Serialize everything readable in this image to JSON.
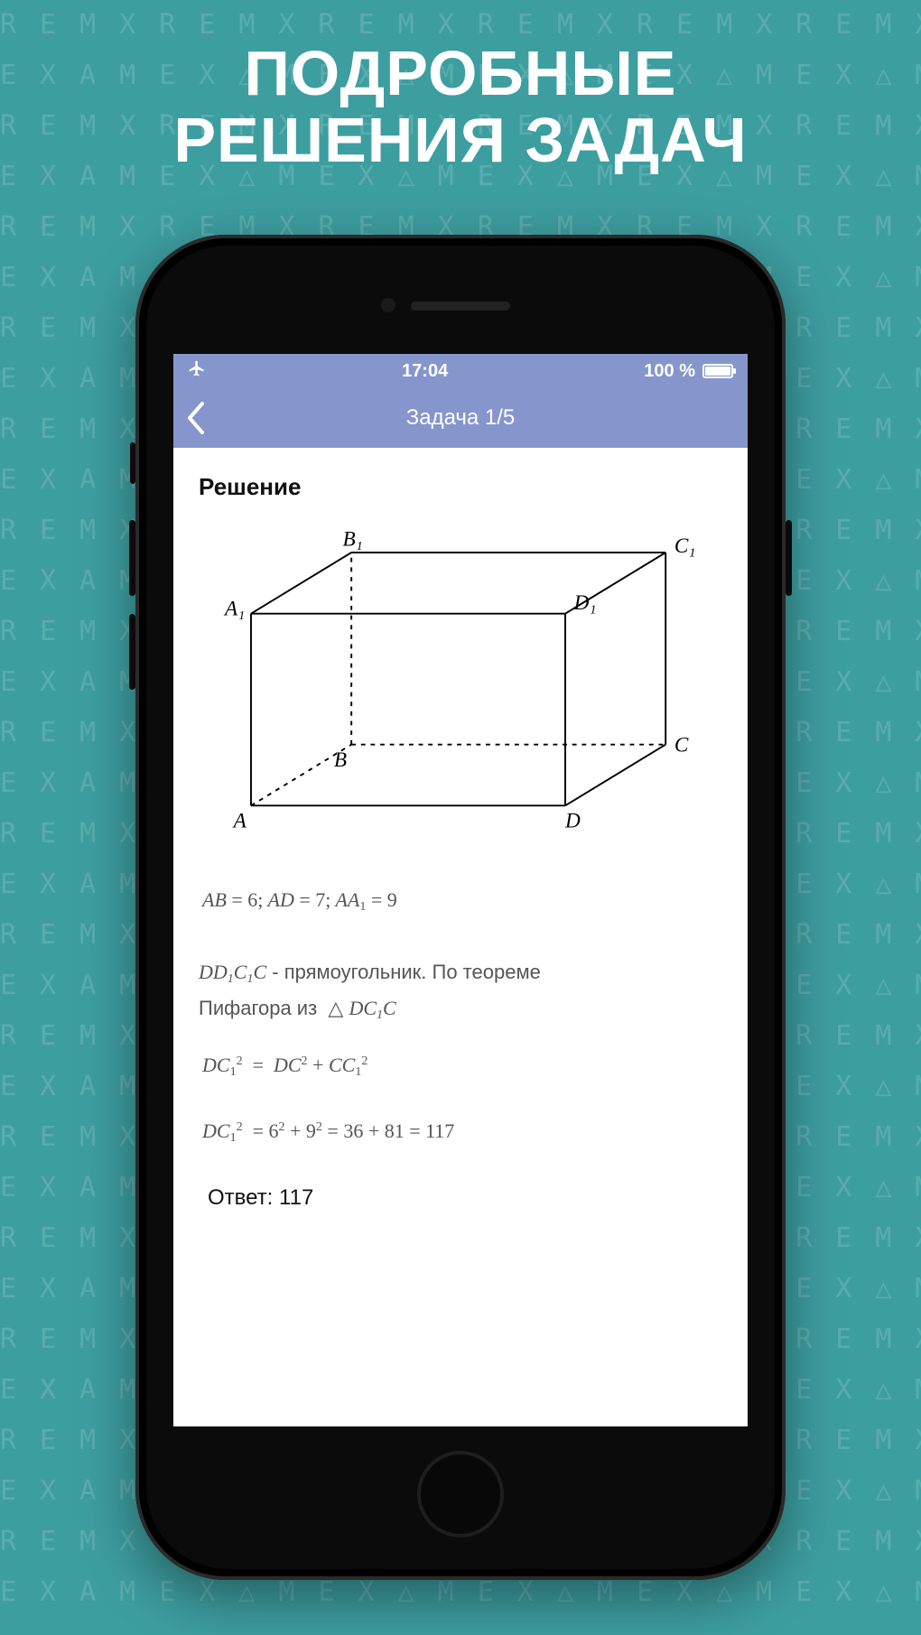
{
  "promo": {
    "line1": "ПОДРОБНЫЕ",
    "line2": "РЕШЕНИЯ ЗАДАЧ"
  },
  "status": {
    "time": "17:04",
    "battery_text": "100 %",
    "airplane_icon": "airplane-icon"
  },
  "nav": {
    "title": "Задача 1/5",
    "back_icon": "chevron-left-icon"
  },
  "solution": {
    "heading": "Решение",
    "figure": {
      "labels": {
        "A": "A",
        "B": "B",
        "C": "C",
        "D": "D",
        "A1": "A₁",
        "B1": "B₁",
        "C1": "C₁",
        "D1": "D₁"
      }
    },
    "given": "AB = 6; AD = 7; AA₁ = 9",
    "line2a": "DD₁C₁C - прямоугольник. По теореме",
    "line2b": "Пифагора из  △ DC₁C",
    "eq1": "DC₁² = DC² + CC₁²",
    "eq2": "DC₁² = 6² + 9² = 36 + 81 = 117",
    "answer_label": "Ответ:",
    "answer_value": "117"
  },
  "colors": {
    "background": "#3d9ea0",
    "header": "#8696cd"
  }
}
